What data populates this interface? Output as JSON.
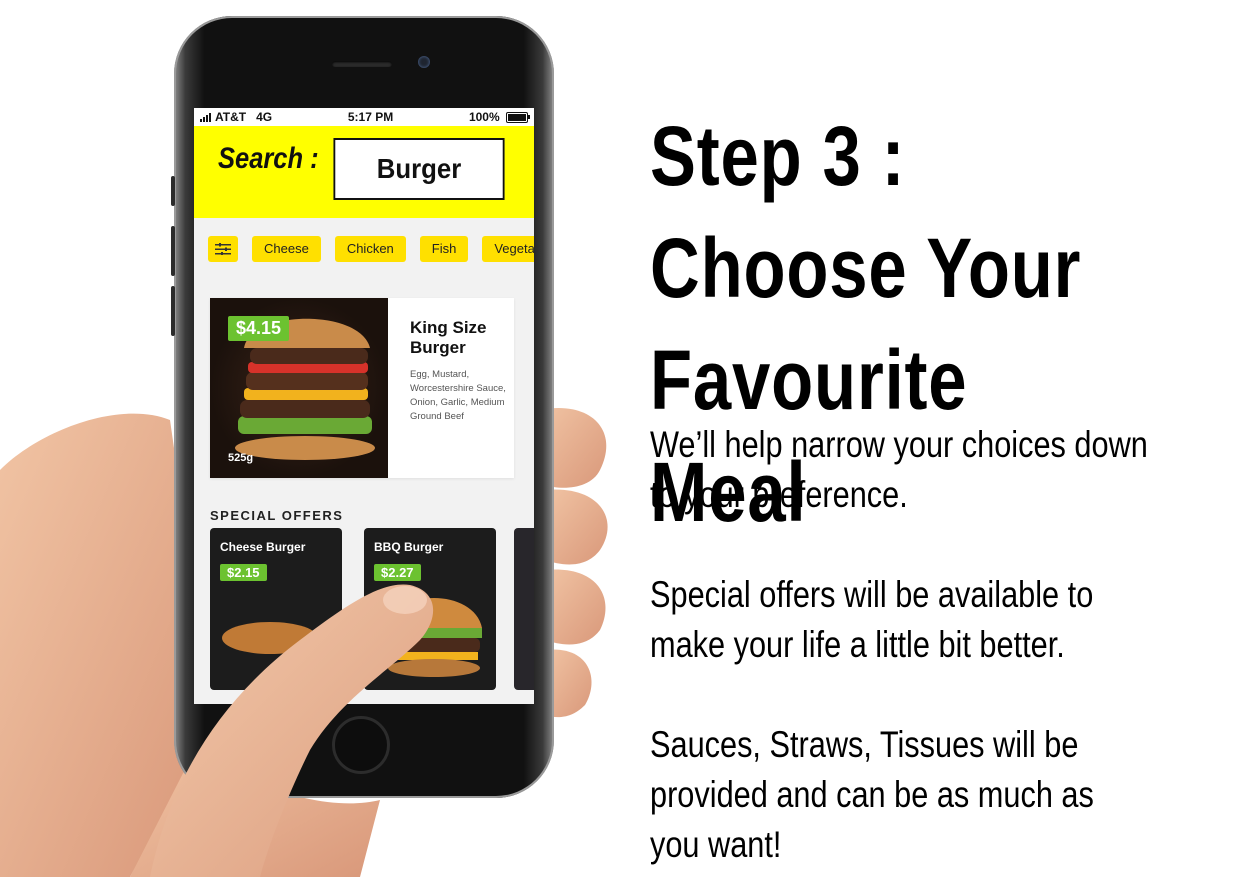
{
  "status_bar": {
    "carrier": "AT&T",
    "network": "4G",
    "time": "5:17 PM",
    "battery": "100%"
  },
  "search": {
    "label": "Search :",
    "value": "Burger"
  },
  "filter_chips": [
    "Cheese",
    "Chicken",
    "Fish",
    "Vegeta"
  ],
  "featured": {
    "price": "$4.15",
    "title": "King Size Burger",
    "description": "Egg, Mustard, Worcestershire Sauce, Onion, Garlic, Medium Ground Beef",
    "weight": "525g"
  },
  "special_offers": {
    "title": "SPECIAL OFFERS",
    "items": [
      {
        "name": "Cheese Burger",
        "price": "$2.15"
      },
      {
        "name": "BBQ Burger",
        "price": "$2.27"
      }
    ]
  },
  "headline": "Step 3 : Choose Your Favourite Meal",
  "paragraphs": [
    "We’ll help narrow your choices down to your preference.",
    "Special offers will be available to make your life a little bit better.",
    "Sauces, Straws, Tissues will be provided and can be as much as you want!"
  ],
  "colors": {
    "search_bar": "#ffff00",
    "chip": "#ffe000",
    "price_tag": "#6cc230"
  }
}
